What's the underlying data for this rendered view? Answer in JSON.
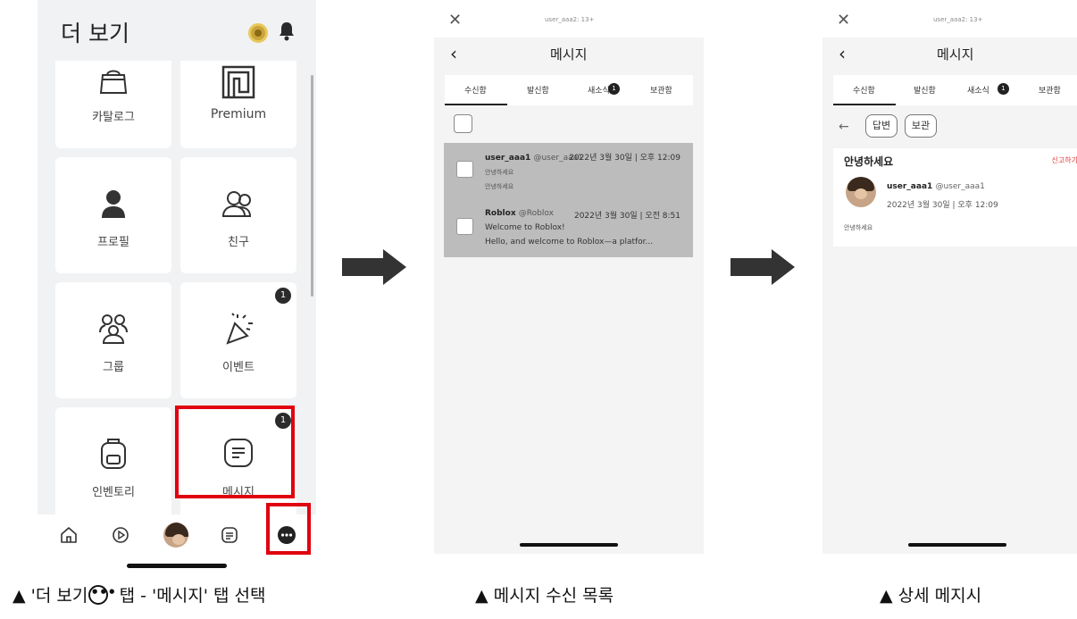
{
  "more_screen": {
    "title": "더 보기",
    "tiles": [
      {
        "label": "카탈로그",
        "icon": "shopping-bag-icon"
      },
      {
        "label": "Premium",
        "icon": "premium-icon"
      },
      {
        "label": "프로필",
        "icon": "profile-icon"
      },
      {
        "label": "친구",
        "icon": "friends-icon"
      },
      {
        "label": "그룹",
        "icon": "groups-icon"
      },
      {
        "label": "이벤트",
        "icon": "party-popper-icon",
        "badge": "1"
      },
      {
        "label": "인벤토리",
        "icon": "backpack-icon"
      },
      {
        "label": "메시지",
        "icon": "message-icon",
        "badge": "1"
      }
    ],
    "nav": [
      "home-icon",
      "play-icon",
      "avatar",
      "chat-icon",
      "more-icon"
    ]
  },
  "messages_list": {
    "top_username": "user_aaa2: 13+",
    "title": "메시지",
    "tabs": [
      {
        "label": "수신함"
      },
      {
        "label": "발신함"
      },
      {
        "label": "새소식",
        "badge": "1"
      },
      {
        "label": "보관함"
      }
    ],
    "messages": [
      {
        "sender": "user_aaa1",
        "handle": "@user_aaa1",
        "date": "2022년 3월 30일 | 오후 12:09",
        "subject": "안녕하세요",
        "preview": "안녕하세요"
      },
      {
        "sender": "Roblox",
        "handle": "@Roblox",
        "date": "2022년 3월 30일 | 오전 8:51",
        "subject": "Welcome to Roblox!",
        "preview": "Hello, and welcome to Roblox—a platfor..."
      }
    ]
  },
  "message_detail": {
    "top_username": "user_aaa2: 13+",
    "title": "메시지",
    "tabs": [
      {
        "label": "수신함"
      },
      {
        "label": "발신함"
      },
      {
        "label": "새소식",
        "badge": "1"
      },
      {
        "label": "보관함"
      }
    ],
    "reply_label": "답변",
    "archive_label": "보관",
    "subject": "안녕하세요",
    "report_label": "신고하기",
    "sender": "user_aaa1",
    "handle": "@user_aaa1",
    "date": "2022년 3월 30일 | 오후 12:09",
    "body": "안녕하세요"
  },
  "captions": {
    "first_a": "▲ '더 보기",
    "first_icon": "•••",
    "first_b": "' 탭 - '메시지' 탭 선택",
    "second": "▲ 메시지 수신 목록",
    "third": "▲ 상세 메지시"
  },
  "colors": {
    "highlight_red": "#e0000f",
    "list_background": "#bcbcbc",
    "report_red": "#e53935"
  }
}
